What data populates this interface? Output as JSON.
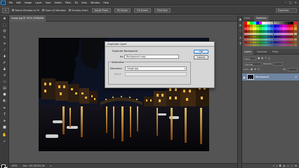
{
  "menubar": {
    "logo": "Ps",
    "items": [
      "File",
      "Edit",
      "Image",
      "Layer",
      "Type",
      "Select",
      "Filter",
      "3D",
      "View",
      "Window",
      "Help"
    ],
    "controls": [
      "–",
      "□",
      "×"
    ]
  },
  "options": {
    "preset_icon": "⌕",
    "resize_windows_label": "Resize Windows to Fit",
    "zoom_all_windows_label": "Zoom All Windows",
    "scrubby_zoom_label": "Scrubby Zoom",
    "actual_pixels_label": "Actual Pixels",
    "fit_screen_label": "Fit Screen",
    "fill_screen_label": "Fill Screen",
    "print_size_label": "Print Size",
    "workspace_label": "Essentials"
  },
  "document": {
    "tab_label": "image.jpg @ 100% (RGB/8#)",
    "close_glyph": "×",
    "status_zoom": "100%",
    "status_doc": "Doc: 332.3K/332.3K",
    "status_arrow": "▸"
  },
  "panels": {
    "color_tab": "Color",
    "swatches_tab": "Swatches",
    "layers_tab": "Layers",
    "channels_tab": "Channels",
    "paths_tab": "Paths",
    "kind_label": "Kind",
    "blend_mode": "Normal",
    "opacity_label": "Opacity:",
    "lock_label": "Lock:",
    "fill_label": "Fill:"
  },
  "layers": {
    "items": [
      {
        "name": "Background",
        "visible": true,
        "locked": true
      }
    ]
  },
  "dialog": {
    "title": "Duplicate Layer",
    "duplicate_label": "Duplicate:",
    "duplicate_value": "Background",
    "as_label": "As:",
    "as_value": "Background copy",
    "destination_title": "Destination",
    "document_label": "Document:",
    "document_value": "image.jpg",
    "name_label": "Name:",
    "ok_label": "OK",
    "cancel_label": "Cancel"
  },
  "colors": {
    "app_bg": "#535353",
    "menu_bg": "#3c3c3c",
    "dialog_bg": "#d6d6d6",
    "selected_layer": "#6f85a1",
    "primary_button": "#b7d7f4"
  },
  "icons": {
    "tools": [
      "move-icon",
      "marquee-icon",
      "lasso-icon",
      "quick-select-icon",
      "crop-icon",
      "eyedropper-icon",
      "healing-brush-icon",
      "brush-icon",
      "clone-stamp-icon",
      "history-brush-icon",
      "eraser-icon",
      "gradient-icon",
      "blur-icon",
      "dodge-icon",
      "pen-icon",
      "type-icon",
      "path-select-icon",
      "shape-icon",
      "hand-icon",
      "zoom-icon"
    ]
  }
}
